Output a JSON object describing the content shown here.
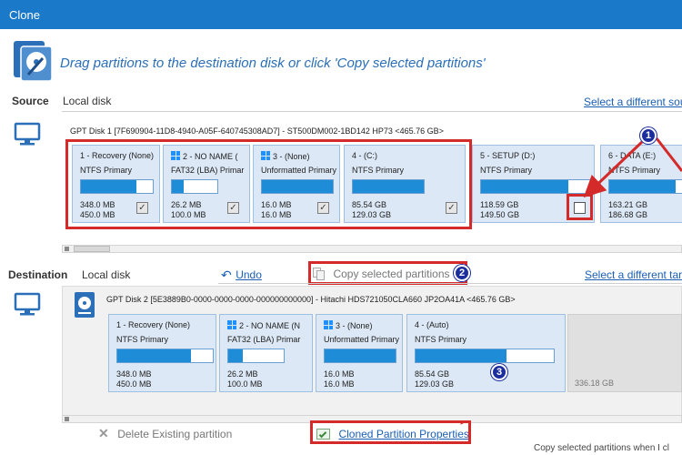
{
  "window": {
    "title": "Clone"
  },
  "header": {
    "instruction": "Drag partitions to the destination disk or click 'Copy selected partitions'"
  },
  "source": {
    "label": "Source",
    "disk_type": "Local disk",
    "select_link": "Select a different sou",
    "disk_header": "GPT Disk 1 [7F690904-11D8-4940-A05F-640745308AD7] - ST500DM002-1BD142 HP73  <465.76 GB>",
    "partitions": [
      {
        "name": "1 - Recovery (None)",
        "type": "NTFS Primary",
        "used": "348.0 MB",
        "total": "450.0 MB",
        "fill": 0.77,
        "checked": true,
        "win": false
      },
      {
        "name": "2 - NO NAME (",
        "type": "FAT32 (LBA) Primar",
        "used": "26.2 MB",
        "total": "100.0 MB",
        "fill": 0.26,
        "checked": true,
        "win": true
      },
      {
        "name": "3 - (None)",
        "type": "Unformatted Primary",
        "used": "16.0 MB",
        "total": "16.0 MB",
        "fill": 1.0,
        "checked": true,
        "win": true
      },
      {
        "name": "4 - (C:)",
        "type": "NTFS Primary",
        "used": "85.54 GB",
        "total": "129.03 GB",
        "fill": 0.66,
        "checked": true,
        "win": false
      },
      {
        "name": "5 - SETUP (D:)",
        "type": "NTFS Primary",
        "used": "118.59 GB",
        "total": "149.50 GB",
        "fill": 0.79,
        "checked": false,
        "win": false
      },
      {
        "name": "6 - DATA (E:)",
        "type": "NTFS Primary",
        "used": "163.21 GB",
        "total": "186.68 GB",
        "fill": 0.87,
        "checked": false,
        "win": false
      }
    ]
  },
  "destination": {
    "label": "Destination",
    "disk_type": "Local disk",
    "undo": "Undo",
    "copy_button": "Copy selected partitions",
    "select_link": "Select a different targ",
    "disk_header": "GPT Disk 2 [5E3889B0-0000-0000-0000-000000000000] - Hitachi HDS721050CLA660 JP2OA41A  <465.76 GB>",
    "partitions": [
      {
        "name": "1 - Recovery (None)",
        "type": "NTFS Primary",
        "used": "348.0 MB",
        "total": "450.0 MB",
        "fill": 0.77,
        "win": false
      },
      {
        "name": "2 - NO NAME (N",
        "type": "FAT32 (LBA) Primar",
        "used": "26.2 MB",
        "total": "100.0 MB",
        "fill": 0.26,
        "win": true
      },
      {
        "name": "3 - (None)",
        "type": "Unformatted Primary",
        "used": "16.0 MB",
        "total": "16.0 MB",
        "fill": 1.0,
        "win": true
      },
      {
        "name": "4 - (Auto)",
        "type": "NTFS Primary",
        "used": "85.54 GB",
        "total": "129.03 GB",
        "fill": 0.66,
        "win": false
      }
    ],
    "unallocated": "336.18 GB",
    "delete_button": "Delete Existing partition",
    "properties_link": "Cloned Partition Properties"
  },
  "footer": {
    "note": "Copy selected partitions when I cl"
  },
  "annotations": {
    "badge1": "1",
    "badge2": "2",
    "badge3": "3"
  },
  "colors": {
    "accent": "#1a79c9",
    "bar_fill": "#1f8cd8",
    "highlight": "#d42a2a",
    "badge": "#1c2e9e"
  },
  "icons": {
    "logo": "clone-disk-icon",
    "monitor": "monitor-icon",
    "hdd": "hdd-icon",
    "undo": "undo-icon",
    "copy": "copy-icon",
    "delete": "delete-x-icon",
    "properties": "properties-icon",
    "windows": "windows-logo-icon"
  }
}
